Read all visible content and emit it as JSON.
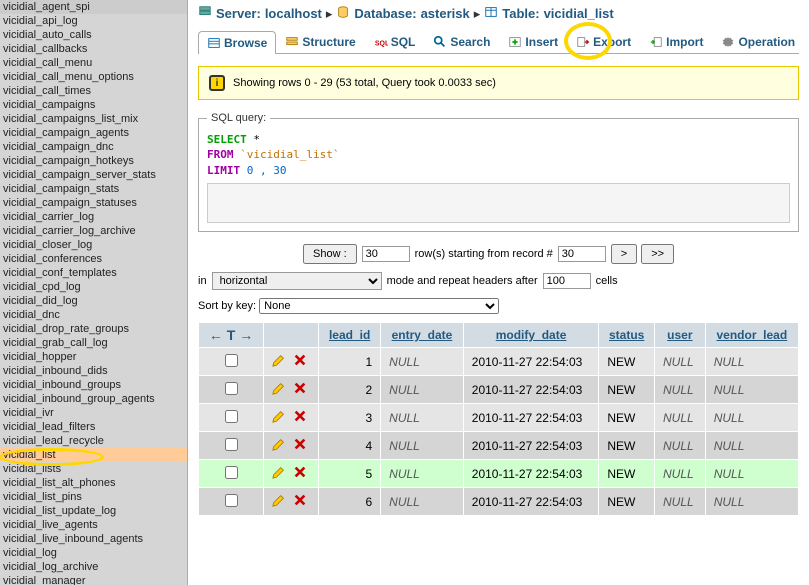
{
  "sidebar": {
    "items": [
      "vicidial_agent_spi",
      "vicidial_api_log",
      "vicidial_auto_calls",
      "vicidial_callbacks",
      "vicidial_call_menu",
      "vicidial_call_menu_options",
      "vicidial_call_times",
      "vicidial_campaigns",
      "vicidial_campaigns_list_mix",
      "vicidial_campaign_agents",
      "vicidial_campaign_dnc",
      "vicidial_campaign_hotkeys",
      "vicidial_campaign_server_stats",
      "vicidial_campaign_stats",
      "vicidial_campaign_statuses",
      "vicidial_carrier_log",
      "vicidial_carrier_log_archive",
      "vicidial_closer_log",
      "vicidial_conferences",
      "vicidial_conf_templates",
      "vicidial_cpd_log",
      "vicidial_did_log",
      "vicidial_dnc",
      "vicidial_drop_rate_groups",
      "vicidial_grab_call_log",
      "vicidial_hopper",
      "vicidial_inbound_dids",
      "vicidial_inbound_groups",
      "vicidial_inbound_group_agents",
      "vicidial_ivr",
      "vicidial_lead_filters",
      "vicidial_lead_recycle",
      "vicidial_list",
      "vicidial_lists",
      "vicidial_list_alt_phones",
      "vicidial_list_pins",
      "vicidial_list_update_log",
      "vicidial_live_agents",
      "vicidial_live_inbound_agents",
      "vicidial_log",
      "vicidial_log_archive",
      "vicidial_manager"
    ],
    "selected": "vicidial_list"
  },
  "breadcrumb": {
    "server_label": "Server:",
    "server_value": "localhost",
    "database_label": "Database:",
    "database_value": "asterisk",
    "table_label": "Table:",
    "table_value": "vicidial_list"
  },
  "tabs": {
    "browse": "Browse",
    "structure": "Structure",
    "sql": "SQL",
    "search": "Search",
    "insert": "Insert",
    "export": "Export",
    "import": "Import",
    "operations": "Operation"
  },
  "info": {
    "text": "Showing rows 0 - 29 (53 total, Query took 0.0033 sec)"
  },
  "sql_query": {
    "legend": "SQL query:",
    "select": "SELECT",
    "star": "*",
    "from": "FROM",
    "table": "`vicidial_list`",
    "limit": "LIMIT",
    "nums": "0 , 30"
  },
  "controls": {
    "show_btn": "Show :",
    "rows_value": "30",
    "rows_label": "row(s) starting from record #",
    "start_value": "30",
    "in_label": "in",
    "mode": "horizontal",
    "repeat_label": "mode and repeat headers after",
    "repeat_value": "100",
    "cells_label": "cells",
    "sort_label": "Sort by key:",
    "sort_value": "None",
    "nav_next": ">",
    "nav_last": ">>"
  },
  "table": {
    "headers": {
      "lead_id": "lead_id",
      "entry_date": "entry_date",
      "modify_date": "modify_date",
      "status": "status",
      "user": "user",
      "vendor_lead": "vendor_lead"
    },
    "rows": [
      {
        "lead_id": "1",
        "entry_date": "NULL",
        "modify_date": "2010-11-27 22:54:03",
        "status": "NEW",
        "user": "NULL",
        "vendor": "NULL",
        "cls": "odd"
      },
      {
        "lead_id": "2",
        "entry_date": "NULL",
        "modify_date": "2010-11-27 22:54:03",
        "status": "NEW",
        "user": "NULL",
        "vendor": "NULL",
        "cls": "even"
      },
      {
        "lead_id": "3",
        "entry_date": "NULL",
        "modify_date": "2010-11-27 22:54:03",
        "status": "NEW",
        "user": "NULL",
        "vendor": "NULL",
        "cls": "odd"
      },
      {
        "lead_id": "4",
        "entry_date": "NULL",
        "modify_date": "2010-11-27 22:54:03",
        "status": "NEW",
        "user": "NULL",
        "vendor": "NULL",
        "cls": "even"
      },
      {
        "lead_id": "5",
        "entry_date": "NULL",
        "modify_date": "2010-11-27 22:54:03",
        "status": "NEW",
        "user": "NULL",
        "vendor": "NULL",
        "cls": "highlight"
      },
      {
        "lead_id": "6",
        "entry_date": "NULL",
        "modify_date": "2010-11-27 22:54:03",
        "status": "NEW",
        "user": "NULL",
        "vendor": "NULL",
        "cls": "even"
      }
    ]
  }
}
